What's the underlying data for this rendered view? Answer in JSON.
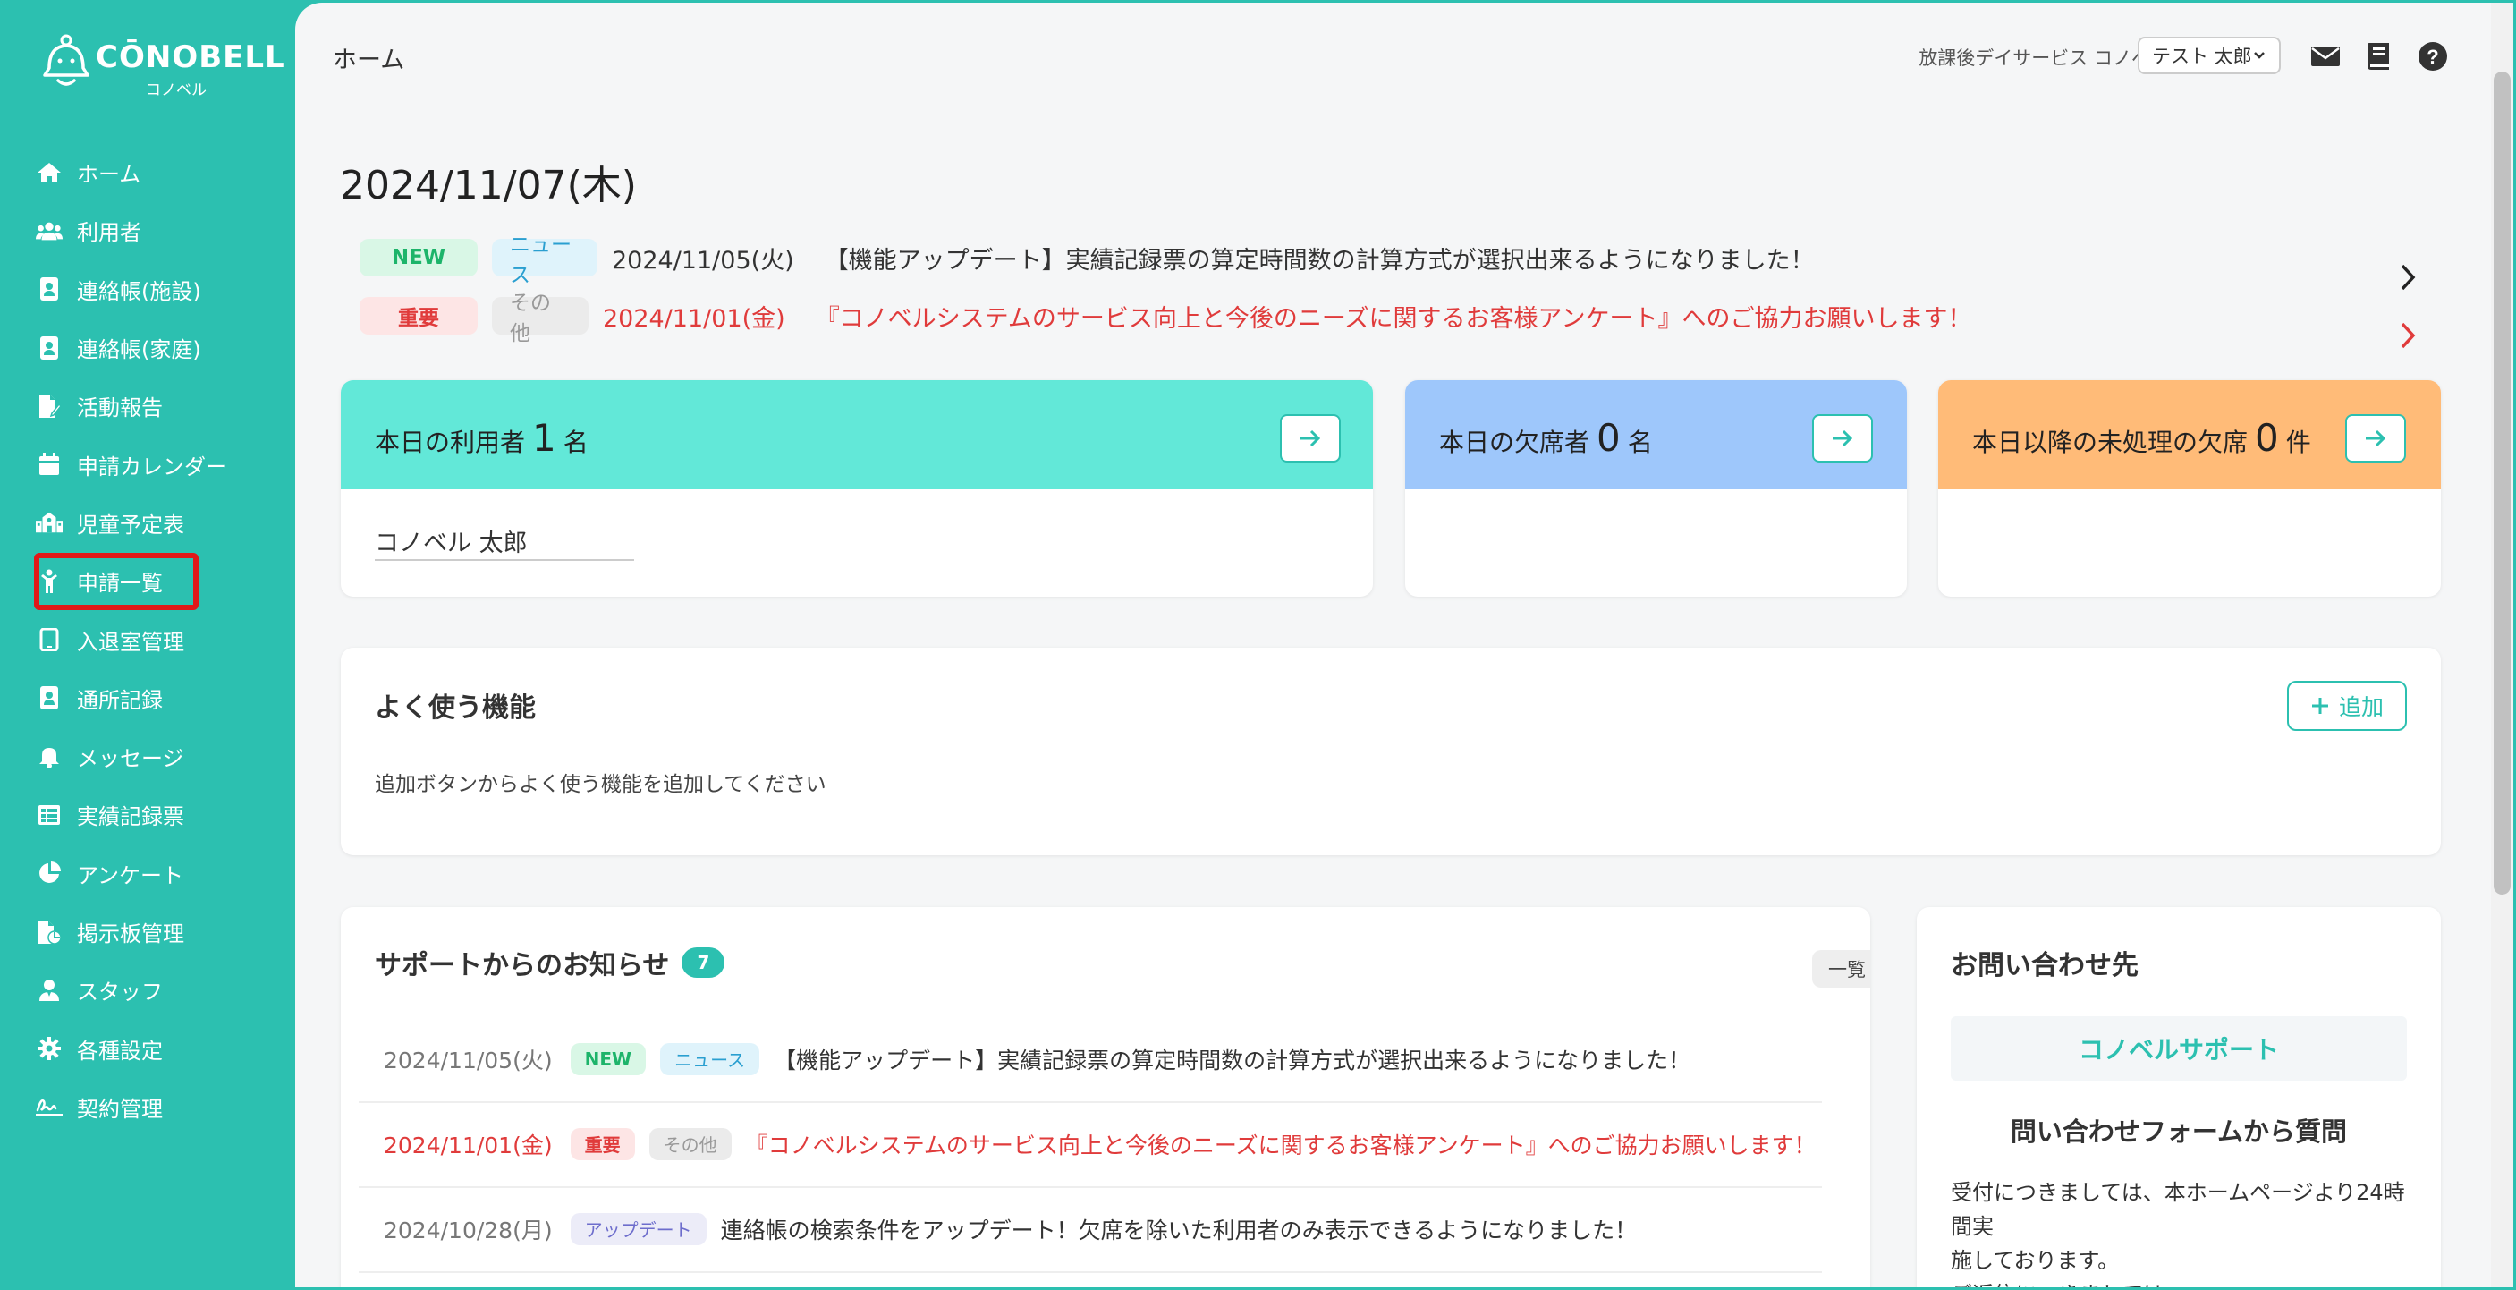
{
  "brand": {
    "name": "CŌNOBELL",
    "sub": "コノベル"
  },
  "colors": {
    "accent": "#2cc0b0",
    "important": "#e03b3b",
    "stat1": "#62e8d8",
    "stat2": "#9ec7fb",
    "stat3": "#ffbb78"
  },
  "sidebar": {
    "items": [
      {
        "label": "ホーム",
        "icon": "home-icon"
      },
      {
        "label": "利用者",
        "icon": "users-icon"
      },
      {
        "label": "連絡帳(施設)",
        "icon": "contact-book-icon"
      },
      {
        "label": "連絡帳(家庭)",
        "icon": "contact-book-icon"
      },
      {
        "label": "活動報告",
        "icon": "file-edit-icon"
      },
      {
        "label": "申請カレンダー",
        "icon": "calendar-icon"
      },
      {
        "label": "児童予定表",
        "icon": "building-icon"
      },
      {
        "label": "申請一覧",
        "icon": "child-icon"
      },
      {
        "label": "入退室管理",
        "icon": "tablet-icon"
      },
      {
        "label": "通所記録",
        "icon": "contact-book-icon"
      },
      {
        "label": "メッセージ",
        "icon": "bell-icon"
      },
      {
        "label": "実績記録票",
        "icon": "table-icon"
      },
      {
        "label": "アンケート",
        "icon": "pie-chart-icon"
      },
      {
        "label": "掲示板管理",
        "icon": "file-chart-icon"
      },
      {
        "label": "スタッフ",
        "icon": "staff-icon"
      },
      {
        "label": "各種設定",
        "icon": "gear-icon"
      },
      {
        "label": "契約管理",
        "icon": "signature-icon"
      }
    ]
  },
  "header": {
    "title": "ホーム",
    "facility": "放課後デイサービス コノベル",
    "user_selected": "テスト 太郎"
  },
  "date_heading": "2024/11/07(木)",
  "top_notices": [
    {
      "badge1": "NEW",
      "badge2": "ニュース",
      "date": "2024/11/05(火)",
      "text": "【機能アップデート】実績記録票の算定時間数の計算方式が選択出来るようになりました！"
    },
    {
      "badge1": "重要",
      "badge2": "その他",
      "date": "2024/11/01(金)",
      "text": "『コノベルシステムのサービス向上と今後のニーズに関するお客様アンケート』へのご協力お願いします！"
    }
  ],
  "stats": [
    {
      "prefix": "本日の利用者",
      "count": "1",
      "unit": "名",
      "entry": "コノベル 太郎"
    },
    {
      "prefix": "本日の欠席者",
      "count": "0",
      "unit": "名",
      "entry": ""
    },
    {
      "prefix": "本日以降の未処理の欠席",
      "count": "0",
      "unit": "件",
      "entry": ""
    }
  ],
  "favorites": {
    "title": "よく使う機能",
    "add_label": "追加",
    "empty_text": "追加ボタンからよく使う機能を追加してください"
  },
  "support": {
    "title": "サポートからのお知らせ",
    "count": "7",
    "list_label": "一覧",
    "rows": [
      {
        "date": "2024/11/05(火)",
        "badge1": "NEW",
        "badge2": "ニュース",
        "text": "【機能アップデート】実績記録票の算定時間数の計算方式が選択出来るようになりました！"
      },
      {
        "date": "2024/11/01(金)",
        "badge1": "重要",
        "badge2": "その他",
        "text": "『コノベルシステムのサービス向上と今後のニーズに関するお客様アンケート』へのご協力お願いします！"
      },
      {
        "date": "2024/10/28(月)",
        "badge1": "アップデート",
        "text": "連絡帳の検索条件をアップデート！欠席を除いた利用者のみ表示できるようになりました！"
      }
    ]
  },
  "contact": {
    "title": "お問い合わせ先",
    "name": "コノベルサポート",
    "subtitle": "問い合わせフォームから質問",
    "body1": "受付につきましては、本ホームページより24時間実",
    "body2": "施しております。",
    "body3": "ご返信につきましては、"
  }
}
